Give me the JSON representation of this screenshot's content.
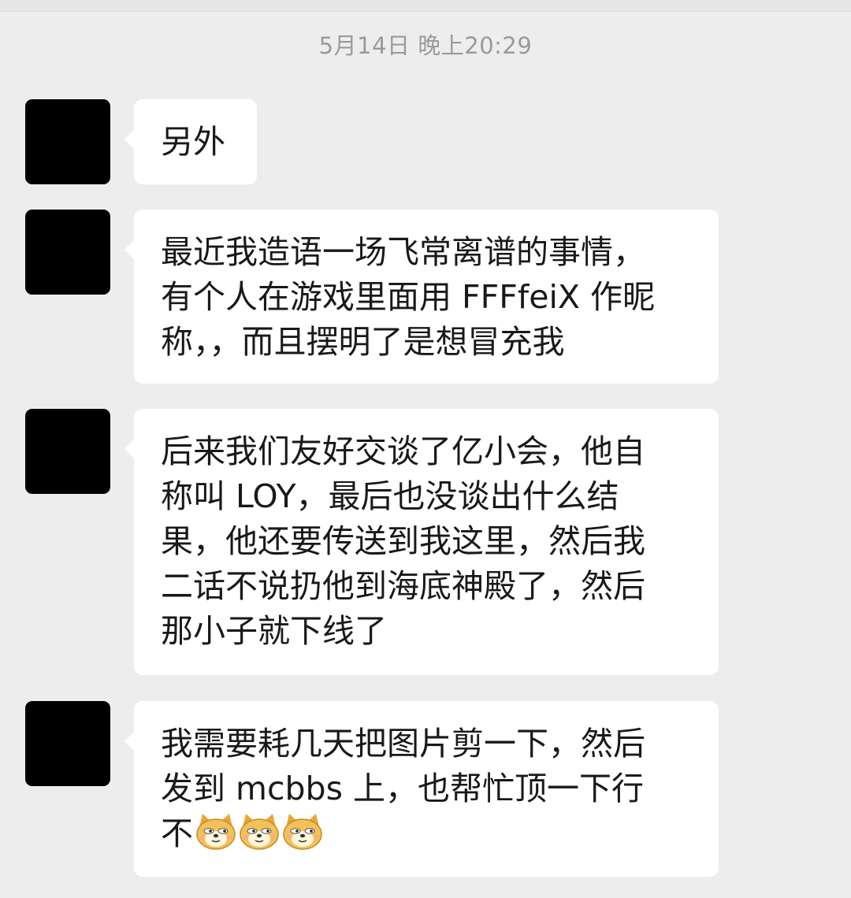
{
  "chat": {
    "timestamp": "5月14日 晚上20:29",
    "messages": [
      {
        "lines": "另外"
      },
      {
        "lines": "最近我造语一场飞常离谱的事情，\n有个人在游戏里面用 FFFfeiX 作昵\n称，，而且摆明了是想冒充我"
      },
      {
        "lines": "后来我们友好交谈了亿小会，他自\n称叫 LOY，最后也没谈出什么结\n果，他还要传送到我这里，然后我\n二话不说扔他到海底神殿了，然后\n那小子就下线了"
      },
      {
        "lines": "我需要耗几天把图片剪一下，然后\n发到 mcbbs 上，也帮忙顶一下行\n不",
        "emoji": [
          "doge-emoji",
          "doge-emoji",
          "doge-emoji"
        ]
      }
    ]
  },
  "colors": {
    "background": "#ededed",
    "bubble": "#ffffff",
    "text": "#191919",
    "timestamp": "#9a9a9a",
    "avatar": "#000000"
  }
}
